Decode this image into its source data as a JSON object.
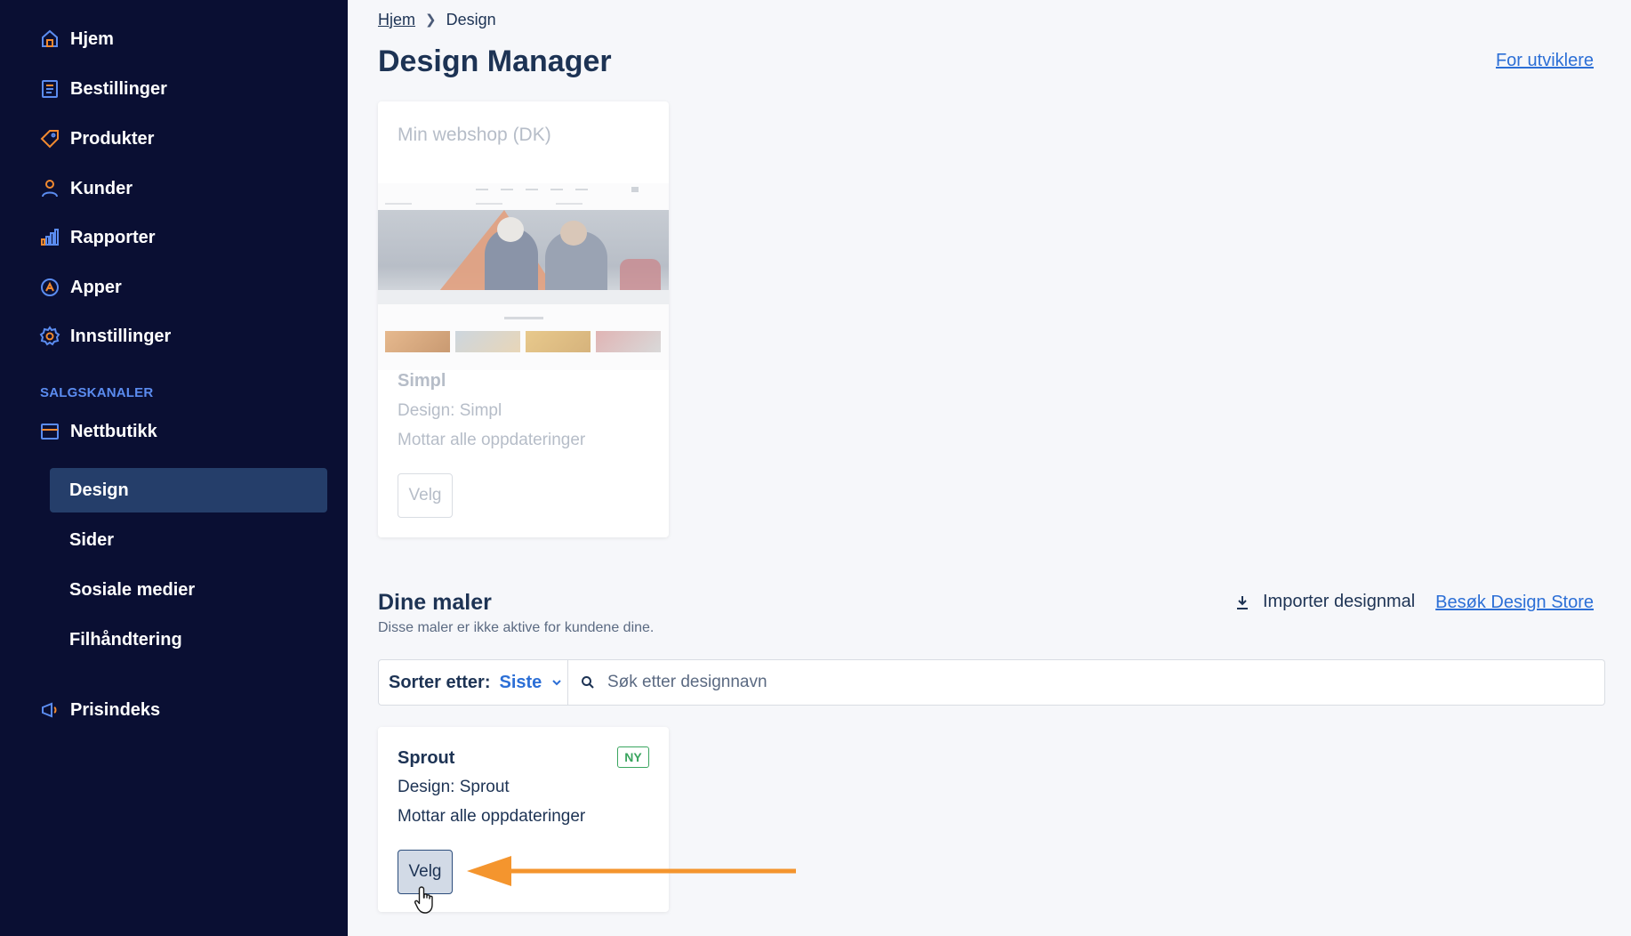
{
  "sidebar": {
    "items": [
      {
        "label": "Hjem",
        "icon": "home-icon"
      },
      {
        "label": "Bestillinger",
        "icon": "orders-icon"
      },
      {
        "label": "Produkter",
        "icon": "tag-icon"
      },
      {
        "label": "Kunder",
        "icon": "user-icon"
      },
      {
        "label": "Rapporter",
        "icon": "bar-chart-icon"
      },
      {
        "label": "Apper",
        "icon": "apps-icon"
      },
      {
        "label": "Innstillinger",
        "icon": "gear-icon"
      }
    ],
    "section_label": "SALGSKANALER",
    "channel": {
      "label": "Nettbutikk",
      "icon": "store-icon"
    },
    "sub_items": [
      {
        "label": "Design",
        "active": true
      },
      {
        "label": "Sider",
        "active": false
      },
      {
        "label": "Sosiale medier",
        "active": false
      },
      {
        "label": "Filhåndtering",
        "active": false
      }
    ],
    "extra": {
      "label": "Prisindeks",
      "icon": "megaphone-icon"
    },
    "colors": {
      "background": "#0a0f33",
      "active": "#253e6a",
      "accent": "#5b8cf0",
      "icon_orange": "#f28a30"
    }
  },
  "breadcrumb": {
    "parent": "Hjem",
    "current": "Design"
  },
  "header": {
    "title": "Design Manager",
    "dev_link": "For utviklere"
  },
  "active_theme": {
    "shop_name": "Min webshop (DK)",
    "template_name": "Simpl",
    "design": "Design: Simpl",
    "updates": "Mottar alle oppdateringer",
    "select_label": "Velg"
  },
  "templates_section": {
    "title": "Dine maler",
    "subtitle": "Disse maler er ikke aktive for kundene dine.",
    "import_label": "Importer designmal",
    "store_link": "Besøk Design Store",
    "sort_label": "Sorter etter:",
    "sort_value": "Siste",
    "search_placeholder": "Søk etter designnavn"
  },
  "templates": [
    {
      "name": "Sprout",
      "badge": "NY",
      "design": "Design: Sprout",
      "updates": "Mottar alle oppdateringer",
      "select_label": "Velg"
    }
  ],
  "colors": {
    "link": "#2c6fd6",
    "text": "#1d3354",
    "badge_green": "#3aa55f",
    "arrow_orange": "#f4952e"
  }
}
